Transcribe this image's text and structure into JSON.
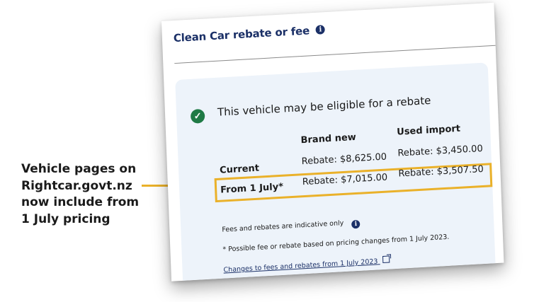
{
  "callout": {
    "line1": "Vehicle pages on",
    "line2": "Rightcar.govt.nz",
    "line3": "now include from",
    "line4": "1 July pricing"
  },
  "section": {
    "title": "Clean Car rebate or fee",
    "info_icon": "info-icon"
  },
  "card": {
    "status_icon": "check-circle-icon",
    "eligibility_text": "This vehicle may be eligible for a rebate",
    "columns": [
      "Brand new",
      "Used import"
    ],
    "rows": [
      {
        "label": "Current",
        "brand_new": "Rebate: $8,625.00",
        "used_import": "Rebate: $3,450.00"
      },
      {
        "label": "From 1 July*",
        "brand_new": "Rebate: $7,015.00",
        "used_import": "Rebate: $3,507.50"
      }
    ],
    "indicative_note": "Fees and rebates are indicative only",
    "footnote": "* Possible fee or rebate based on pricing changes from 1 July 2023.",
    "link_text": "Changes to fees and rebates from 1 July 2023"
  },
  "colors": {
    "highlight": "#eab12a",
    "title": "#1b3067",
    "check": "#1f7a45",
    "card_bg": "#edf3fa"
  }
}
